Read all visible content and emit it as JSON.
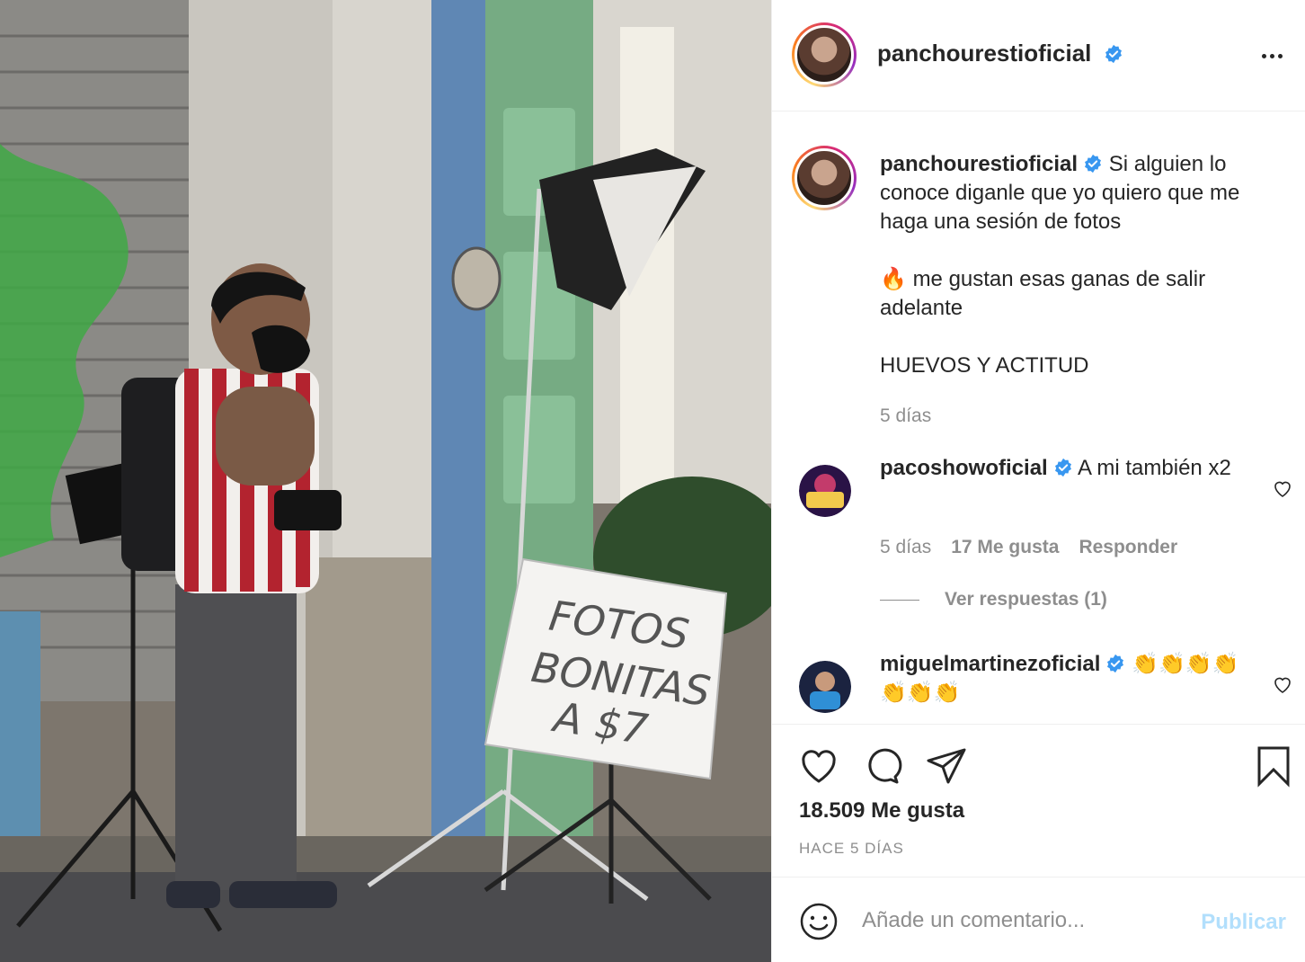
{
  "post": {
    "photo": {
      "description_icon": "photo-icon",
      "sign_lines": [
        "FOTOS",
        "BONITAS",
        "A $7"
      ]
    },
    "header": {
      "username": "panchourestioficial",
      "verified_icon": "verified-badge-icon",
      "more_icon": "more-options-icon"
    },
    "caption": {
      "username": "panchourestioficial",
      "text_1": "Si alguien lo conoce diganle que yo quiero que me haga una sesión de fotos",
      "emoji": "🔥",
      "text_2": "me gustan esas ganas de salir adelante",
      "text_3": "HUEVOS Y ACTITUD",
      "time": "5 días"
    },
    "comments": [
      {
        "username": "pacoshowoficial",
        "text": "A mi también x2",
        "time": "5 días",
        "likes": "17 Me gusta",
        "reply": "Responder",
        "view_replies": "Ver respuestas (1)"
      },
      {
        "username": "miguelmartinezoficial",
        "text": "👏👏👏👏👏👏👏"
      }
    ],
    "actions": {
      "like_icon": "heart-icon",
      "comment_icon": "comment-icon",
      "share_icon": "share-icon",
      "save_icon": "bookmark-icon"
    },
    "likes": "18.509 Me gusta",
    "posted": "HACE 5 DÍAS",
    "add_comment": {
      "placeholder": "Añade un comentario...",
      "publish": "Publicar",
      "emoji_icon": "emoji-icon"
    }
  },
  "colors": {
    "text": "#262626",
    "muted": "#8e8e8e",
    "verified": "#3897f0",
    "publish_disabled": "#b2dffc",
    "divider": "#efefef"
  }
}
